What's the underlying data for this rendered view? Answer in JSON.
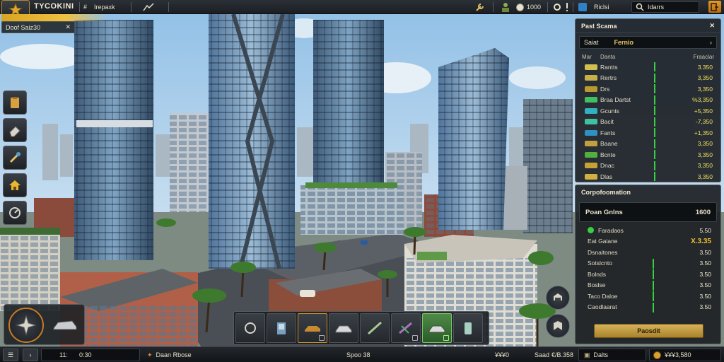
{
  "topbar": {
    "title": "TYCOKINI",
    "menu_label": "Irepaxk",
    "coins": "1000"
  },
  "sub_bar": {
    "label": "Doof Saiz30"
  },
  "market_panel": {
    "title": "Past Scama",
    "sub_label": "Saiat",
    "sub_value": "Fernio",
    "col_left": "Mar",
    "col_mid": "Danta",
    "col_right": "Fraaclar",
    "rows": [
      {
        "name": "Rantts",
        "value": "3.350",
        "icon_color": "#d0c050"
      },
      {
        "name": "Rertrs",
        "value": "3,350",
        "icon_color": "#c8b048"
      },
      {
        "name": "Drs",
        "value": "3,350",
        "icon_color": "#b89a30"
      },
      {
        "name": "Braa Dartst",
        "value": "%3,350",
        "icon_color": "#40c060"
      },
      {
        "name": "Gcunts",
        "value": "+5,350",
        "icon_color": "#30b0c0"
      },
      {
        "name": "Bacit",
        "value": "-7,350",
        "icon_color": "#40c0a0"
      },
      {
        "name": "Fants",
        "value": "+1,350",
        "icon_color": "#3090c0"
      },
      {
        "name": "Baane",
        "value": "3,350",
        "icon_color": "#c0a040"
      },
      {
        "name": "Bcnte",
        "value": "3,350",
        "icon_color": "#50b040"
      },
      {
        "name": "Dnac",
        "value": "3,350",
        "icon_color": "#c8a038"
      },
      {
        "name": "Dlas",
        "value": "3,350",
        "icon_color": "#d0b040"
      }
    ]
  },
  "corp_panel": {
    "title": "Corpofoomation",
    "total_label": "Poan Gnlns",
    "total_value": "1600",
    "rows": [
      {
        "name": "Faradaos",
        "value": "5.50",
        "hi": false
      },
      {
        "name": "Eat Gaiane",
        "value": "X.3.35",
        "hi": true
      },
      {
        "name": "Dsnaitones",
        "value": "3.50",
        "hi": false
      },
      {
        "name": "Sotslcnto",
        "value": "3.50",
        "hi": false
      },
      {
        "name": "Bolnds",
        "value": "3.50",
        "hi": false
      },
      {
        "name": "Boslse",
        "value": "3.50",
        "hi": false
      },
      {
        "name": "Taco Daloe",
        "value": "3.50",
        "hi": false
      },
      {
        "name": "Caodlaarat",
        "value": "3.50",
        "hi": false
      }
    ],
    "button_label": "Paosdit"
  },
  "statusbar": {
    "time_num": "11:",
    "time_val": "0:30",
    "player_label": "Daan Rbose",
    "center_label": "Spoo 38",
    "money_left": "¥¥¥0",
    "stat_label": "Saad",
    "stat_value": "€/B.358",
    "deals_label": "Dalts",
    "balance": "¥¥¥3,580"
  },
  "toolbar": {
    "slots": [
      "road",
      "building",
      "truck",
      "car",
      "pipe",
      "crane",
      "car-selected",
      "phone",
      "extra"
    ]
  }
}
